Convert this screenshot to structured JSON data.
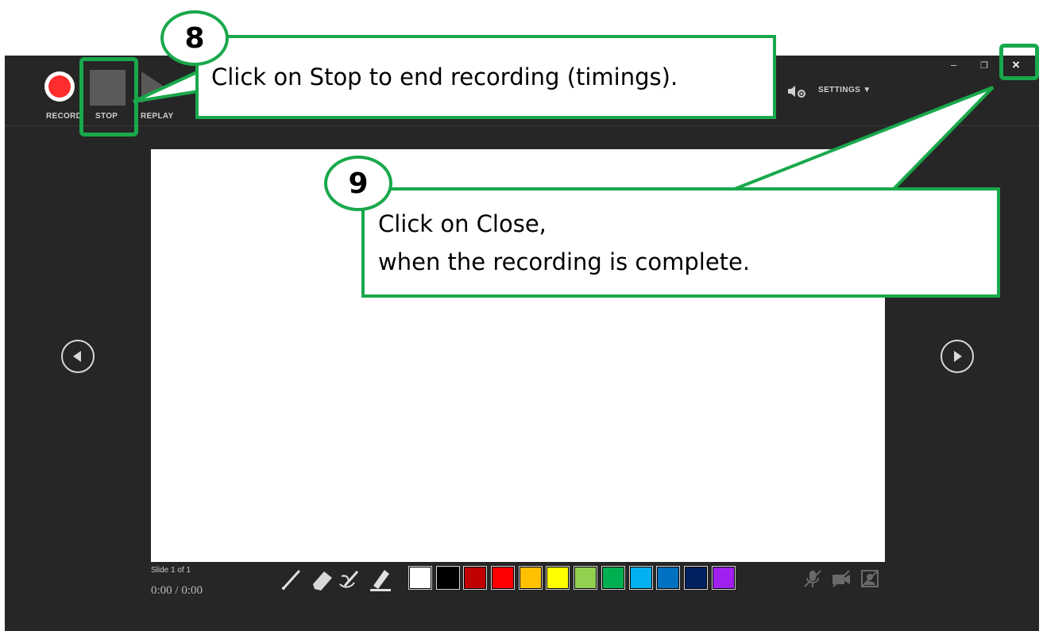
{
  "toolbar": {
    "record_label": "RECORD",
    "stop_label": "STOP",
    "replay_label": "REPLAY",
    "settings_label": "SETTINGS ▼"
  },
  "window_controls": {
    "minimize": "–",
    "restore": "❐",
    "close": "×"
  },
  "slide_info": {
    "counter": "Slide 1 of 1",
    "time": "0:00 / 0:00"
  },
  "pen_colors": [
    "#ffffff",
    "#000000",
    "#c00000",
    "#ff0000",
    "#ffc000",
    "#ffff00",
    "#92d050",
    "#00b050",
    "#00b0f0",
    "#0070c0",
    "#002060",
    "#a020f0"
  ],
  "icons": {
    "previous": "chevron-left-icon",
    "next": "chevron-right-icon",
    "settings": "settings-icon",
    "pen": "pen-icon",
    "eraser": "eraser-icon",
    "pen_eraser": "pen-eraser-icon",
    "highlighter": "highlighter-icon",
    "mic": "microphone-muted-icon",
    "camera": "camera-off-icon",
    "preview": "camera-preview-off-icon"
  },
  "callouts": {
    "step8_number": "8",
    "step8_text": "Click on Stop to end recording (timings).",
    "step9_number": "9",
    "step9_line1": "Click on Close,",
    "step9_line2": "when the recording is complete."
  },
  "accent_color": "#19a84b"
}
